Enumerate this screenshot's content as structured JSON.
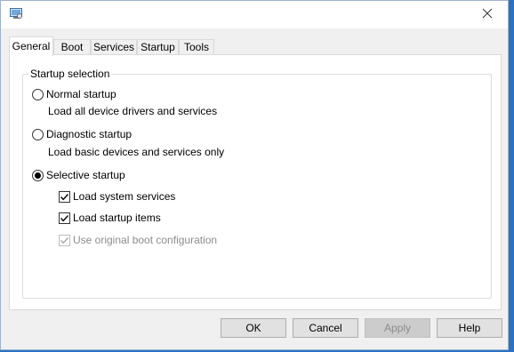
{
  "window": {
    "icon": "system-config-icon",
    "close_icon": "close-icon"
  },
  "tabs": [
    {
      "label": "General",
      "active": true
    },
    {
      "label": "Boot",
      "active": false
    },
    {
      "label": "Services",
      "active": false
    },
    {
      "label": "Startup",
      "active": false
    },
    {
      "label": "Tools",
      "active": false
    }
  ],
  "startup_selection": {
    "title": "Startup selection",
    "normal": {
      "label": "Normal startup",
      "description": "Load all device drivers and services",
      "selected": false
    },
    "diagnostic": {
      "label": "Diagnostic startup",
      "description": "Load basic devices and services only",
      "selected": false
    },
    "selective": {
      "label": "Selective startup",
      "selected": true,
      "options": {
        "system_services": {
          "label": "Load system services",
          "checked": true,
          "enabled": true
        },
        "startup_items": {
          "label": "Load startup items",
          "checked": true,
          "enabled": true
        },
        "original_boot": {
          "label": "Use original boot configuration",
          "checked": true,
          "enabled": false
        }
      }
    }
  },
  "buttons": {
    "ok": "OK",
    "cancel": "Cancel",
    "apply": "Apply",
    "help": "Help"
  }
}
